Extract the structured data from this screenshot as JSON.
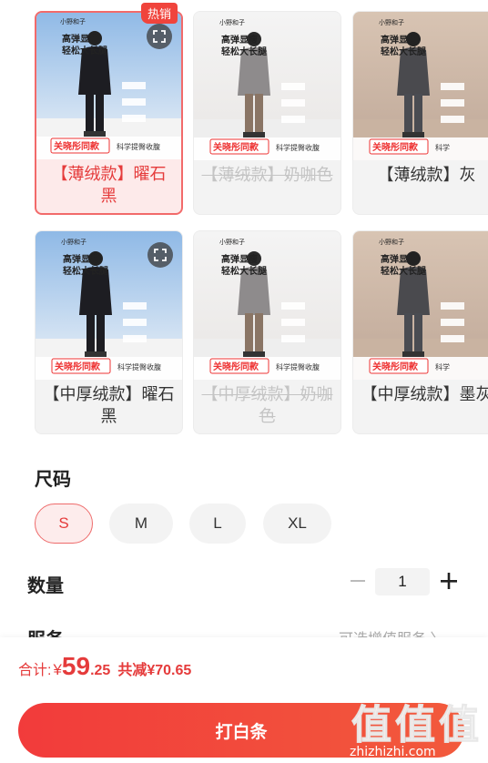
{
  "variants": [
    {
      "label": "【薄绒款】曜石黑",
      "state": "selected",
      "hot_tag": "热销",
      "zoomable": true,
      "image": {
        "brand": "小野和子",
        "line1": "高弹显瘦",
        "line2": "轻松大长腿",
        "banner": "关晓彤同款",
        "sub": "科学提臀收腹",
        "style": "black-snow"
      }
    },
    {
      "label": "【薄绒款】奶咖色",
      "state": "disabled",
      "hot_tag": "",
      "zoomable": false,
      "image": {
        "brand": "小野和子",
        "line1": "高弹显瘦",
        "line2": "轻松大长腿",
        "banner": "关晓彤同款",
        "sub": "科学提臀收腹",
        "style": "mocha"
      }
    },
    {
      "label": "【薄绒款】灰",
      "state": "normal",
      "hot_tag": "",
      "zoomable": false,
      "image": {
        "brand": "小野和子",
        "line1": "高弹显瘦",
        "line2": "轻松大长腿",
        "banner": "关晓彤同款",
        "sub": "科学",
        "style": "grey"
      }
    },
    {
      "label": "【中厚绒款】曜石黑",
      "state": "normal",
      "hot_tag": "",
      "zoomable": true,
      "image": {
        "brand": "小野和子",
        "line1": "高弹显瘦",
        "line2": "轻松大长腿",
        "banner": "关晓彤同款",
        "sub": "科学提臀收腹",
        "style": "black-snow"
      }
    },
    {
      "label": "【中厚绒款】奶咖色",
      "state": "disabled",
      "hot_tag": "",
      "zoomable": false,
      "image": {
        "brand": "小野和子",
        "line1": "高弹显瘦",
        "line2": "轻松大长腿",
        "banner": "关晓彤同款",
        "sub": "科学提臀收腹",
        "style": "mocha"
      }
    },
    {
      "label": "【中厚绒款】墨灰",
      "state": "normal",
      "hot_tag": "",
      "zoomable": false,
      "image": {
        "brand": "小野和子",
        "line1": "高弹显瘦",
        "line2": "轻松大长腿",
        "banner": "关晓彤同款",
        "sub": "科学",
        "style": "grey"
      }
    }
  ],
  "size": {
    "title": "尺码",
    "options": [
      {
        "label": "S",
        "active": true
      },
      {
        "label": "M",
        "active": false
      },
      {
        "label": "L",
        "active": false
      },
      {
        "label": "XL",
        "active": false
      }
    ]
  },
  "quantity": {
    "title": "数量",
    "minus": "−",
    "value": "1",
    "plus": "+"
  },
  "services": {
    "title": "服务",
    "hint": "可选增值服务 〉"
  },
  "footer": {
    "total_label": "合计:",
    "currency": "¥",
    "price_int": "59",
    "price_dec": ".25",
    "saving": "共减¥70.65",
    "pay_button": "打白条"
  },
  "watermark": {
    "glyphs": [
      "值",
      "值",
      "值"
    ],
    "url": "zhizhizhi.com"
  },
  "colors": {
    "accent": "#e53b3b",
    "button": "#f23b3b",
    "selected_bg": "#fdeaea",
    "neutral_bg": "#f3f3f3"
  }
}
